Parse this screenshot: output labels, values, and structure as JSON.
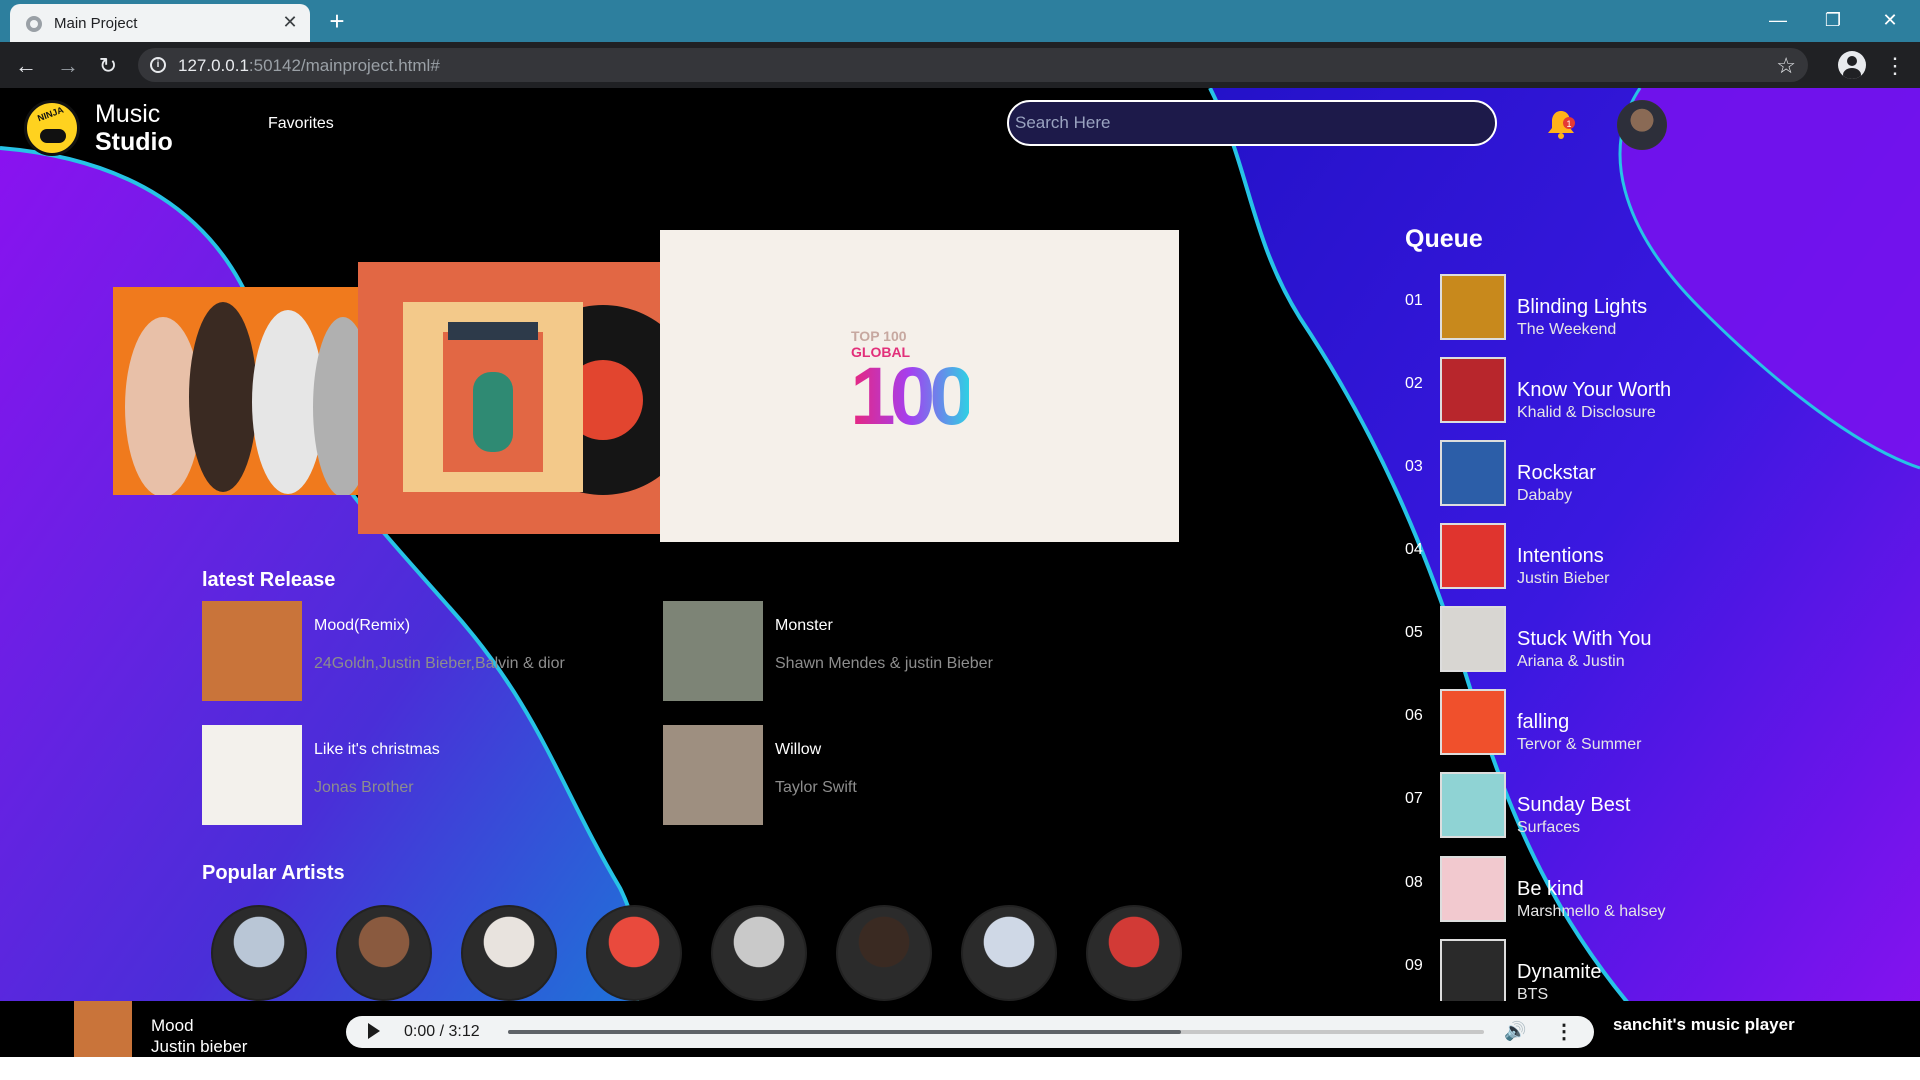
{
  "browser": {
    "tab_title": "Main Project",
    "url_host": "127.0.0.1",
    "url_rest": ":50142/mainproject.html#"
  },
  "header": {
    "brand_line1": "Music",
    "brand_line2": "Studio",
    "nav_favorites": "Favorites",
    "search_placeholder": "Search Here",
    "notification_count": "1"
  },
  "carousel": {
    "top100_label": "TOP 100",
    "top100_global": "GLOBAL",
    "top100_digits": "100"
  },
  "latest_release": {
    "title": "latest Release",
    "items": [
      {
        "title": "Mood(Remix)",
        "artist": "24Goldn,Justin Bieber,Balvin & dior",
        "color": "#c9743a"
      },
      {
        "title": "Monster",
        "artist": "Shawn Mendes & justin Bieber",
        "color": "#7d8476"
      },
      {
        "title": "Like it's christmas",
        "artist": "Jonas Brother",
        "color": "#f3f1ec"
      },
      {
        "title": "Willow",
        "artist": "Taylor Swift",
        "color": "#9e8f80"
      }
    ]
  },
  "popular_artists": {
    "title": "Popular Artists",
    "avatars": [
      "#b9c6d6",
      "#8a5a3f",
      "#e8e3de",
      "#e94a3d",
      "#c9c9c9",
      "#3a2a22",
      "#cfd8e6",
      "#d23a36"
    ]
  },
  "queue": {
    "title": "Queue",
    "items": [
      {
        "num": "01",
        "song": "Blinding Lights",
        "artist": "The Weekend",
        "color": "#c8891c"
      },
      {
        "num": "02",
        "song": "Know Your Worth",
        "artist": "Khalid & Disclosure",
        "color": "#b8262c"
      },
      {
        "num": "03",
        "song": "Rockstar",
        "artist": "Dababy",
        "color": "#2c5ea8"
      },
      {
        "num": "04",
        "song": "Intentions",
        "artist": "Justin Bieber",
        "color": "#e0342e"
      },
      {
        "num": "05",
        "song": "Stuck With You",
        "artist": "Ariana & Justin",
        "color": "#d8d6d2"
      },
      {
        "num": "06",
        "song": "falling",
        "artist": "Tervor & Summer",
        "color": "#f0502c"
      },
      {
        "num": "07",
        "song": "Sunday Best",
        "artist": "Surfaces",
        "color": "#8fd3d4"
      },
      {
        "num": "08",
        "song": "Be kind",
        "artist": "Marshmello & halsey",
        "color": "#f2c9cf"
      },
      {
        "num": "09",
        "song": "Dynamite",
        "artist": "BTS",
        "color": "#2a2a2a"
      }
    ]
  },
  "player": {
    "song": "Mood",
    "artist": "Justin bieber",
    "time": "0:00 / 3:12",
    "buffered_fraction": 0.69,
    "label": "sanchit's music player"
  },
  "colors": {
    "accent_wave": "#2d1bd6",
    "accent_purple": "#8a12f0",
    "accent_cyan": "#27c3e6",
    "bell": "#ffb21a"
  }
}
